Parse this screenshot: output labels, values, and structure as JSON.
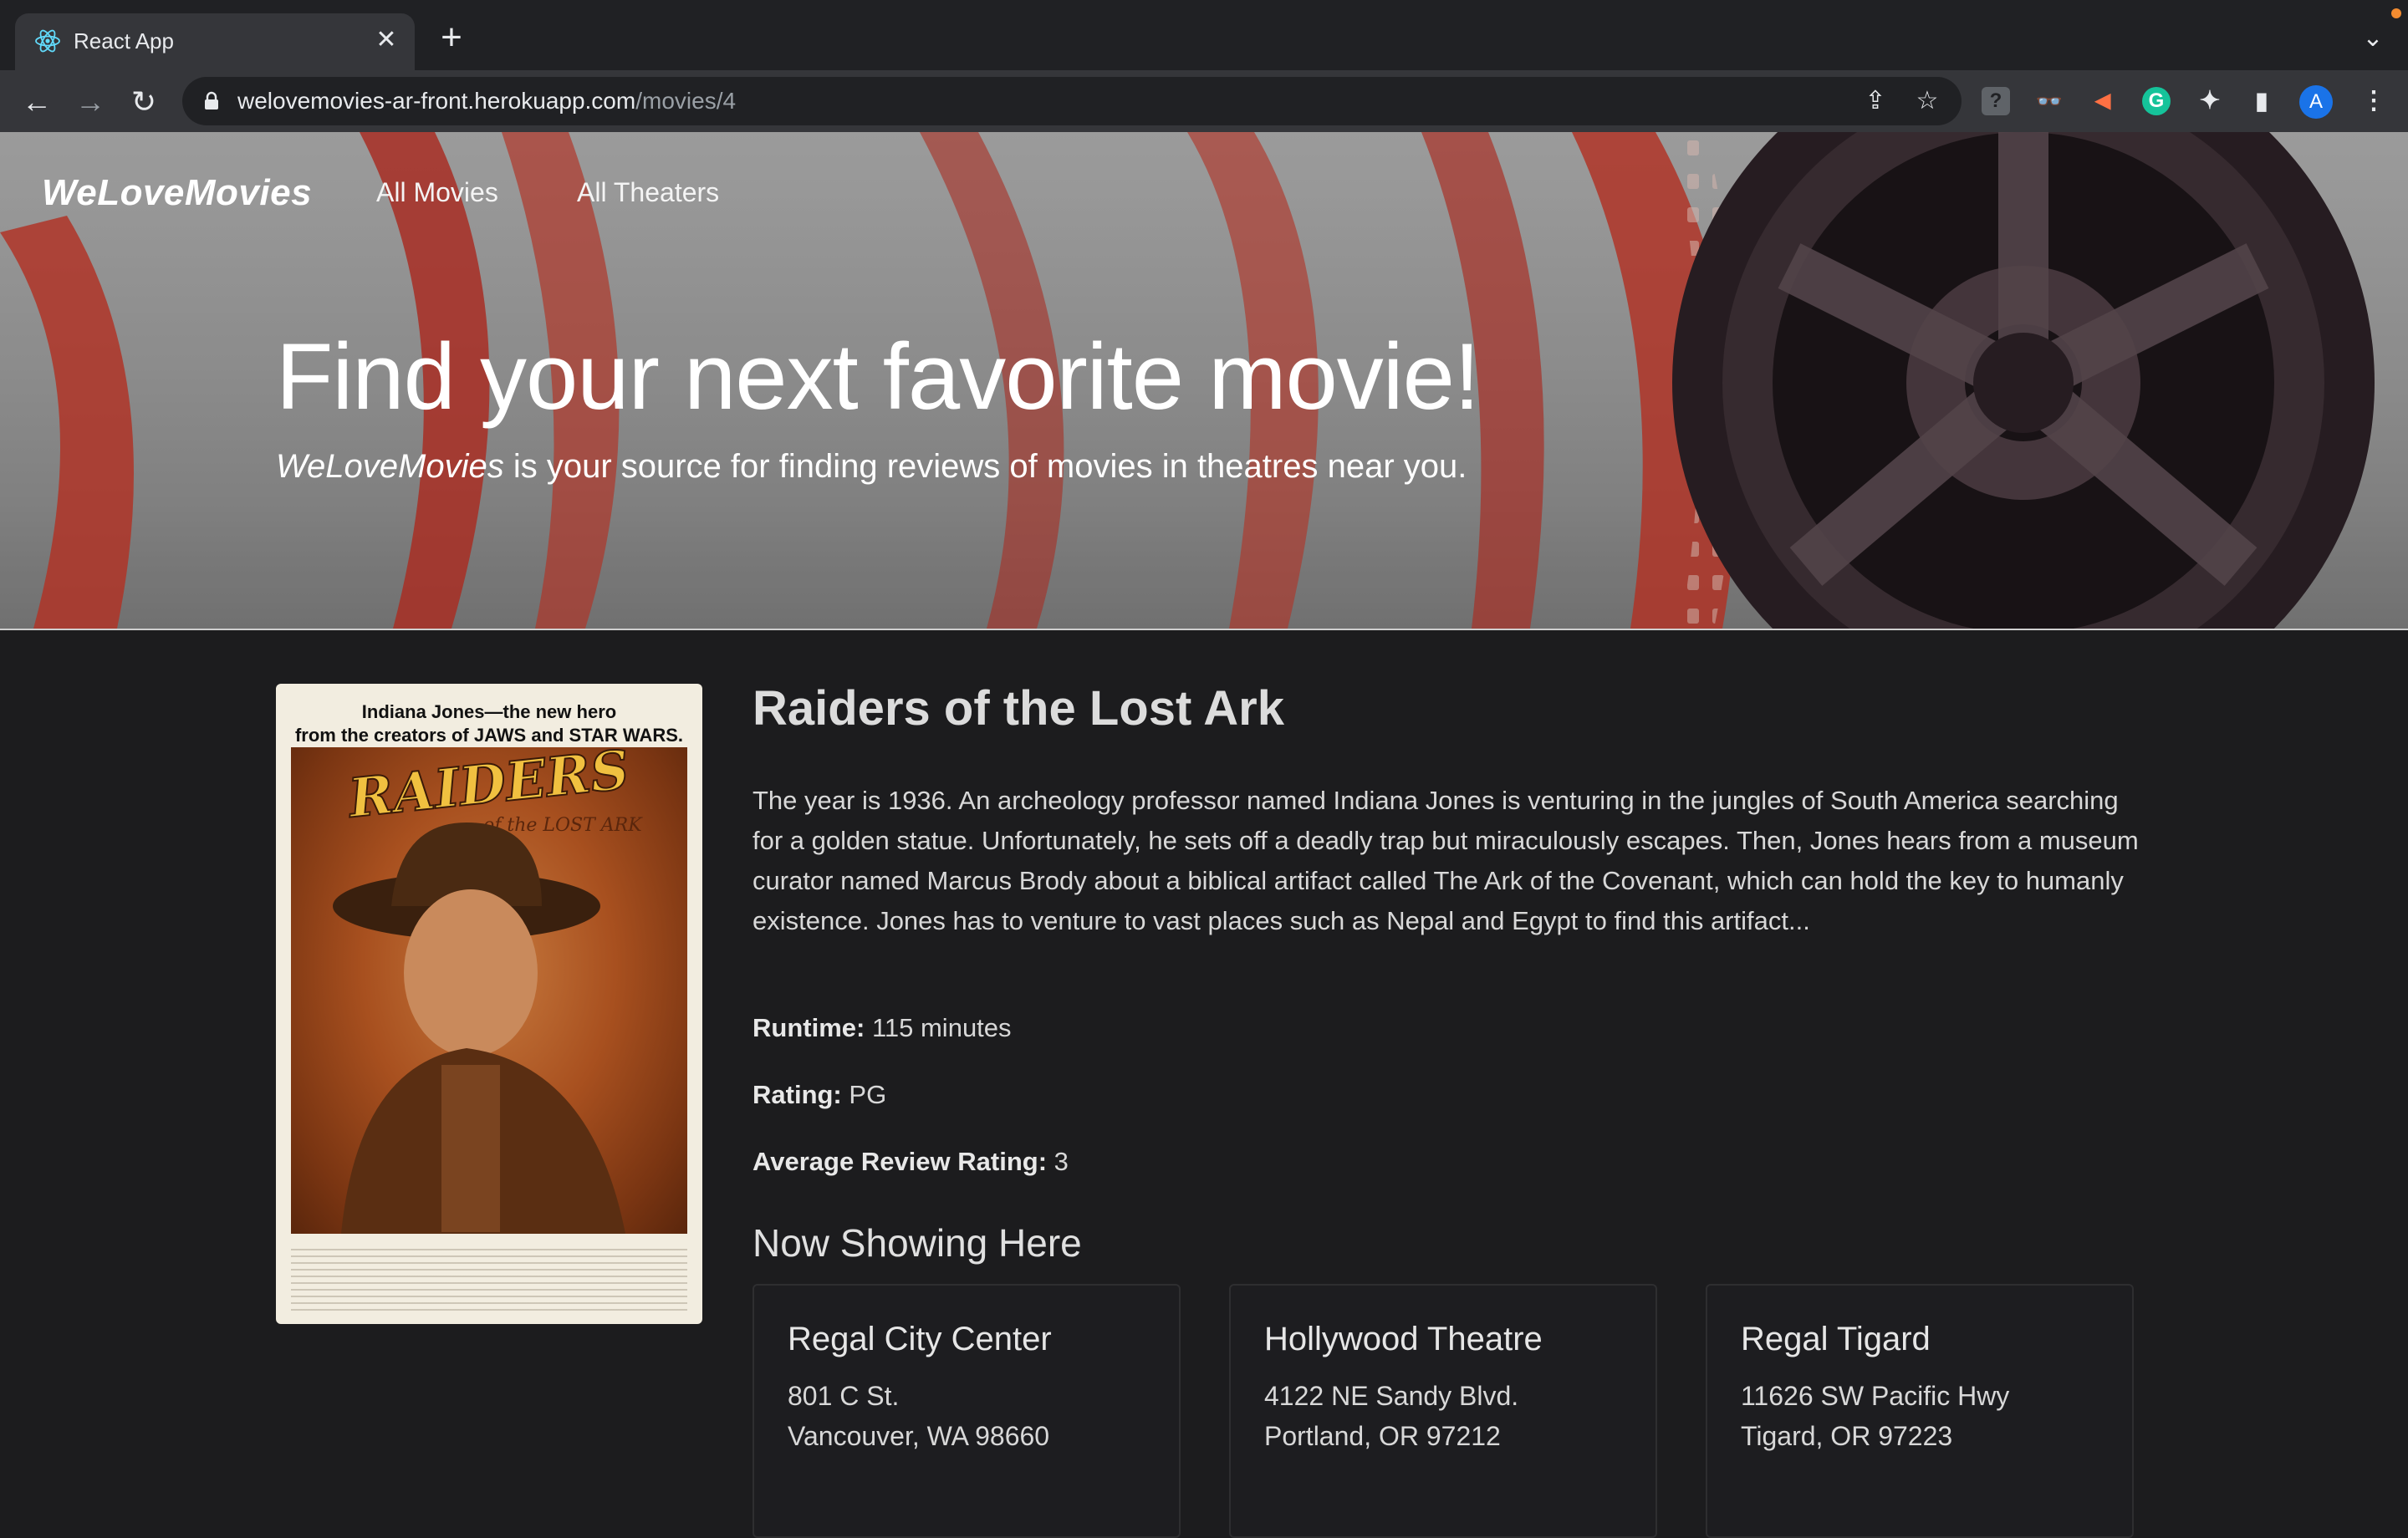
{
  "browser": {
    "tab_title": "React App",
    "url_host": "welovemovies-ar-front.herokuapp.com",
    "url_path": "/movies/4",
    "avatar_letter": "A"
  },
  "nav": {
    "brand": "WeLoveMovies",
    "links": [
      "All Movies",
      "All Theaters"
    ]
  },
  "hero": {
    "title": "Find your next favorite movie!",
    "subtitle_brand": "WeLoveMovies",
    "subtitle_rest": " is your source for finding reviews of movies in theatres near you."
  },
  "poster": {
    "tagline_1": "Indiana Jones—the new hero",
    "tagline_2": "from the creators of JAWS and STAR WARS.",
    "logo_text": "RAIDERS of the LOST ARK"
  },
  "movie": {
    "title": "Raiders of the Lost Ark",
    "description": "The year is 1936. An archeology professor named Indiana Jones is venturing in the jungles of South America searching for a golden statue. Unfortunately, he sets off a deadly trap but miraculously escapes. Then, Jones hears from a museum curator named Marcus Brody about a biblical artifact called The Ark of the Covenant, which can hold the key to humanly existence. Jones has to venture to vast places such as Nepal and Egypt to find this artifact...",
    "runtime_label": "Runtime:",
    "runtime_value": "115 minutes",
    "rating_label": "Rating:",
    "rating_value": "PG",
    "avg_label": "Average Review Rating:",
    "avg_value": "3"
  },
  "showing": {
    "heading": "Now Showing Here",
    "theaters": [
      {
        "name": "Regal City Center",
        "line1": "801 C St.",
        "line2": "Vancouver, WA 98660"
      },
      {
        "name": "Hollywood Theatre",
        "line1": "4122 NE Sandy Blvd.",
        "line2": "Portland, OR 97212"
      },
      {
        "name": "Regal Tigard",
        "line1": "11626 SW Pacific Hwy",
        "line2": "Tigard, OR 97223"
      }
    ]
  }
}
